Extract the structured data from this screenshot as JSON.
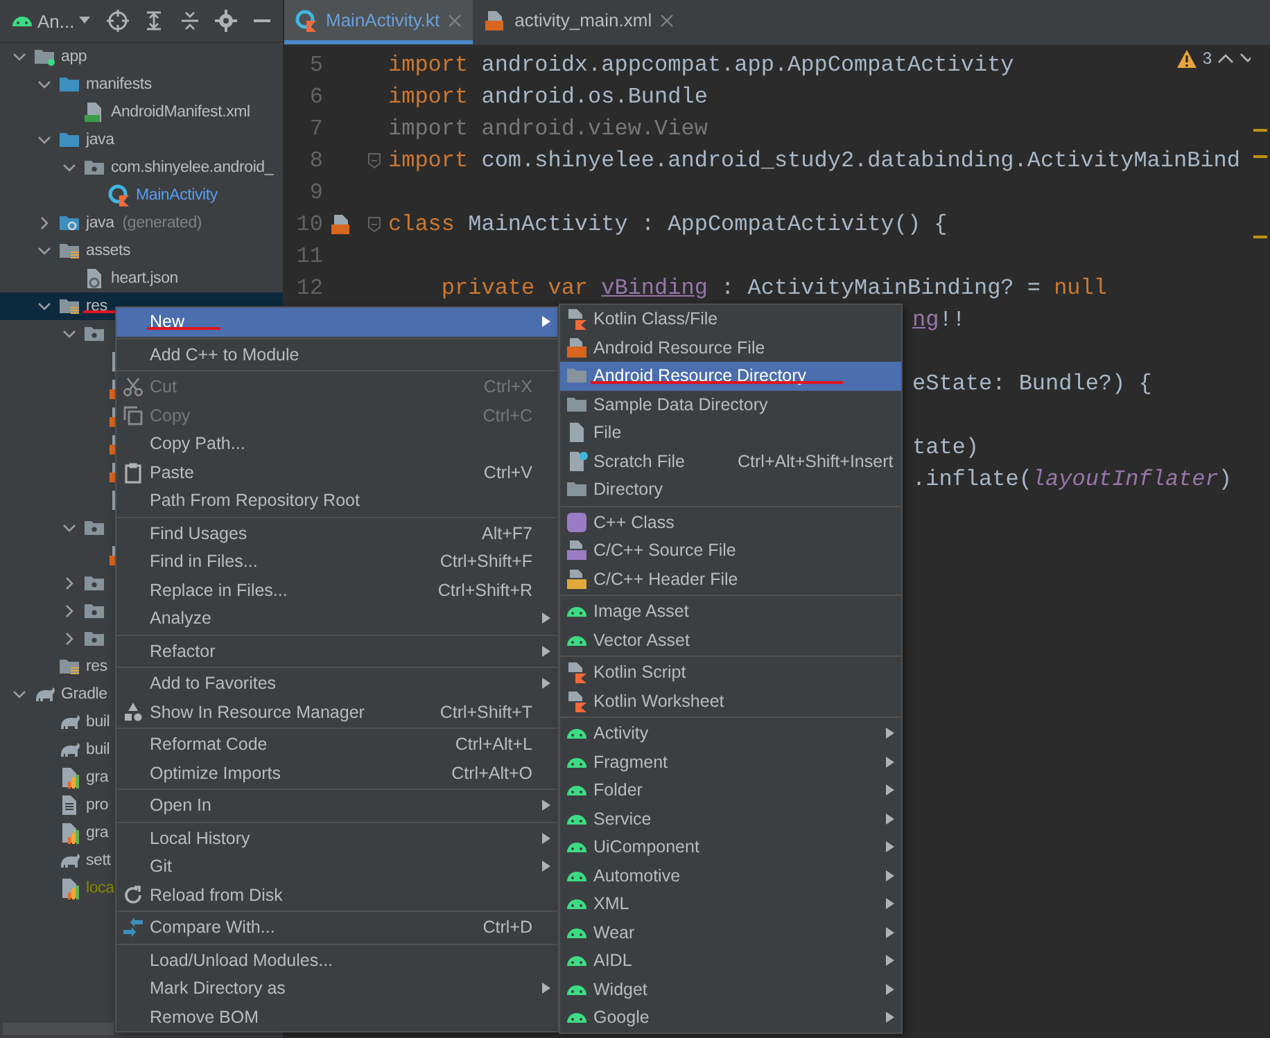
{
  "project_view": {
    "label": "An..."
  },
  "tree": [
    {
      "label": "app",
      "kind": "module-folder",
      "expanded": true,
      "selected": false,
      "children": [
        {
          "label": "manifests",
          "kind": "source-folder",
          "expanded": true,
          "selected": false,
          "children": [
            {
              "label": "AndroidManifest.xml",
              "kind": "manifest-file",
              "selected": false
            }
          ]
        },
        {
          "label": "java",
          "kind": "source-folder",
          "expanded": true,
          "selected": false,
          "children": [
            {
              "label": "com.shinyelee.android_",
              "kind": "package",
              "expanded": true,
              "selected": false,
              "children": [
                {
                  "label": "MainActivity",
                  "kind": "kotlin-class",
                  "modified": true,
                  "selected": false
                }
              ]
            }
          ]
        },
        {
          "label": "java",
          "note": "(generated)",
          "kind": "generated-folder",
          "expanded": false,
          "selected": false
        },
        {
          "label": "assets",
          "kind": "resource-folder",
          "expanded": true,
          "selected": false,
          "children": [
            {
              "label": "heart.json",
              "kind": "json-file",
              "selected": false
            }
          ]
        },
        {
          "label": "res",
          "kind": "resource-folder",
          "expanded": true,
          "selected": true,
          "annotated": true,
          "children": [
            {
              "kind": "package",
              "expanded": true,
              "selected": false,
              "children": [
                {
                  "kind": "file",
                  "selected": false
                },
                {
                  "kind": "layout-file",
                  "selected": false
                },
                {
                  "kind": "layout-file",
                  "selected": false
                },
                {
                  "kind": "layout-file",
                  "selected": false
                },
                {
                  "kind": "layout-file",
                  "selected": false
                },
                {
                  "kind": "file",
                  "selected": false
                }
              ]
            },
            {
              "kind": "package",
              "expanded": true,
              "selected": false,
              "children": [
                {
                  "kind": "layout-file",
                  "selected": false
                }
              ]
            },
            {
              "kind": "package",
              "expanded": false,
              "selected": false
            },
            {
              "kind": "package",
              "expanded": false,
              "selected": false
            },
            {
              "kind": "package",
              "expanded": false,
              "selected": false
            }
          ]
        },
        {
          "label": "res",
          "kind": "resource-folder",
          "selected": false
        }
      ]
    },
    {
      "label": "Gradle",
      "kind": "gradle",
      "expanded": true,
      "selected": false,
      "children": [
        {
          "label": "buil",
          "kind": "gradle",
          "selected": false
        },
        {
          "label": "buil",
          "kind": "gradle",
          "selected": false
        },
        {
          "label": "gra",
          "kind": "properties-file",
          "selected": false
        },
        {
          "label": "pro",
          "kind": "text-file",
          "selected": false
        },
        {
          "label": "gra",
          "kind": "properties-file",
          "selected": false
        },
        {
          "label": "sett",
          "kind": "gradle",
          "selected": false
        },
        {
          "label": "loca",
          "kind": "properties-file",
          "ignored": true,
          "selected": false
        }
      ]
    }
  ],
  "tabs": [
    {
      "label": "MainActivity.kt",
      "kind": "kotlin-class",
      "selected": true
    },
    {
      "label": "activity_main.xml",
      "kind": "layout-file",
      "selected": false
    }
  ],
  "editor": {
    "warnings": "3",
    "lines": [
      {
        "kind": "line",
        "number": "5",
        "tokens": [
          {
            "text": "import",
            "kind": "keyword"
          },
          {
            "text": " androidx.appcompat.app.AppCompatActivity",
            "kind": "plain"
          }
        ]
      },
      {
        "kind": "line",
        "number": "6",
        "tokens": [
          {
            "text": "import",
            "kind": "keyword"
          },
          {
            "text": " android.os.Bundle",
            "kind": "plain"
          }
        ]
      },
      {
        "kind": "line",
        "number": "7",
        "tokens": [
          {
            "text": "import android.view.View",
            "kind": "unused"
          }
        ]
      },
      {
        "kind": "line",
        "number": "8",
        "fold": true,
        "tokens": [
          {
            "text": "import",
            "kind": "keyword"
          },
          {
            "text": " com.shinyelee.android_study2.databinding.ActivityMainBind",
            "kind": "plain"
          }
        ]
      },
      {
        "kind": "line",
        "number": "9"
      },
      {
        "kind": "line",
        "number": "10",
        "fold": true,
        "gutter_marker": true,
        "tokens": [
          {
            "text": "class",
            "kind": "keyword"
          },
          {
            "text": " MainActivity : AppCompatActivity() {",
            "kind": "plain"
          }
        ]
      },
      {
        "kind": "line",
        "number": "11"
      },
      {
        "kind": "line",
        "number": "12",
        "tokens": [
          {
            "text": "    private var ",
            "kind": "keyword"
          },
          {
            "text": "vBinding",
            "kind": "field"
          },
          {
            "text": " : ActivityMainBinding? = ",
            "kind": "plain"
          },
          {
            "text": "null",
            "kind": "keyword"
          }
        ]
      },
      {
        "kind": "tail",
        "tokens": [
          {
            "text": "ng",
            "kind": "field"
          },
          {
            "text": "!!",
            "kind": "plain"
          }
        ]
      },
      {
        "kind": "blank"
      },
      {
        "kind": "tail",
        "tokens": [
          {
            "text": "eState: Bundle?) {",
            "kind": "plain"
          }
        ]
      },
      {
        "kind": "blank"
      },
      {
        "kind": "tail",
        "tokens": [
          {
            "text": "tate)",
            "kind": "plain"
          }
        ]
      },
      {
        "kind": "tail",
        "tokens": [
          {
            "text": ".inflate(",
            "kind": "plain"
          },
          {
            "text": "layoutInflater",
            "kind": "italic-field"
          },
          {
            "text": ")",
            "kind": "plain"
          }
        ]
      }
    ]
  },
  "context_menu": {
    "groups": [
      [
        {
          "label": "New",
          "submenu": true,
          "disabled": false,
          "selected": true,
          "annotated": true
        }
      ],
      [
        {
          "label": "Add C++ to Module",
          "submenu": false,
          "disabled": false,
          "selected": false
        }
      ],
      [
        {
          "label": "Cut",
          "kind": "scissors",
          "shortcut": "Ctrl+X",
          "submenu": false,
          "disabled": true,
          "selected": false
        },
        {
          "label": "Copy",
          "kind": "copy",
          "shortcut": "Ctrl+C",
          "submenu": false,
          "disabled": true,
          "selected": false
        },
        {
          "label": "Copy Path...",
          "submenu": false,
          "disabled": false,
          "selected": false
        },
        {
          "label": "Paste",
          "kind": "clipboard",
          "shortcut": "Ctrl+V",
          "submenu": false,
          "disabled": false,
          "selected": false
        },
        {
          "label": "Path From Repository Root",
          "submenu": false,
          "disabled": false,
          "selected": false
        }
      ],
      [
        {
          "label": "Find Usages",
          "shortcut": "Alt+F7",
          "submenu": false,
          "disabled": false,
          "selected": false
        },
        {
          "label": "Find in Files...",
          "shortcut": "Ctrl+Shift+F",
          "submenu": false,
          "disabled": false,
          "selected": false
        },
        {
          "label": "Replace in Files...",
          "shortcut": "Ctrl+Shift+R",
          "submenu": false,
          "disabled": false,
          "selected": false
        },
        {
          "label": "Analyze",
          "submenu": true,
          "disabled": false,
          "selected": false
        }
      ],
      [
        {
          "label": "Refactor",
          "submenu": true,
          "disabled": false,
          "selected": false
        }
      ],
      [
        {
          "label": "Add to Favorites",
          "submenu": true,
          "disabled": false,
          "selected": false
        },
        {
          "label": "Show In Resource Manager",
          "kind": "shapes",
          "shortcut": "Ctrl+Shift+T",
          "submenu": false,
          "disabled": false,
          "selected": false
        }
      ],
      [
        {
          "label": "Reformat Code",
          "shortcut": "Ctrl+Alt+L",
          "submenu": false,
          "disabled": false,
          "selected": false
        },
        {
          "label": "Optimize Imports",
          "shortcut": "Ctrl+Alt+O",
          "submenu": false,
          "disabled": false,
          "selected": false
        }
      ],
      [
        {
          "label": "Open In",
          "submenu": true,
          "disabled": false,
          "selected": false
        }
      ],
      [
        {
          "label": "Local History",
          "submenu": true,
          "disabled": false,
          "selected": false
        },
        {
          "label": "Git",
          "submenu": true,
          "disabled": false,
          "selected": false
        },
        {
          "label": "Reload from Disk",
          "kind": "reload",
          "submenu": false,
          "disabled": false,
          "selected": false
        }
      ],
      [
        {
          "label": "Compare With...",
          "kind": "compare",
          "shortcut": "Ctrl+D",
          "submenu": false,
          "disabled": false,
          "selected": false
        }
      ],
      [
        {
          "label": "Load/Unload Modules...",
          "submenu": false,
          "disabled": false,
          "selected": false
        },
        {
          "label": "Mark Directory as",
          "submenu": true,
          "disabled": false,
          "selected": false
        },
        {
          "label": "Remove BOM",
          "submenu": false,
          "disabled": false,
          "selected": false
        }
      ]
    ]
  },
  "submenu": {
    "groups": [
      [
        {
          "label": "Kotlin Class/File",
          "kind": "kotlin-file",
          "submenu": false,
          "selected": false
        },
        {
          "label": "Android Resource File",
          "kind": "resource-file",
          "submenu": false,
          "selected": false
        },
        {
          "label": "Android Resource Directory",
          "kind": "folder",
          "submenu": false,
          "selected": true,
          "annotated": true
        },
        {
          "label": "Sample Data Directory",
          "kind": "folder",
          "submenu": false,
          "selected": false
        },
        {
          "label": "File",
          "kind": "file",
          "submenu": false,
          "selected": false
        },
        {
          "label": "Scratch File",
          "kind": "scratch-file",
          "shortcut": "Ctrl+Alt+Shift+Insert",
          "submenu": false,
          "selected": false
        },
        {
          "label": "Directory",
          "kind": "folder",
          "submenu": false,
          "selected": false
        }
      ],
      [
        {
          "label": "C++ Class",
          "kind": "cpp-class",
          "submenu": false,
          "selected": false
        },
        {
          "label": "C/C++ Source File",
          "kind": "cpp-source",
          "submenu": false,
          "selected": false
        },
        {
          "label": "C/C++ Header File",
          "kind": "cpp-header",
          "submenu": false,
          "selected": false
        }
      ],
      [
        {
          "label": "Image Asset",
          "kind": "android",
          "submenu": false,
          "selected": false
        },
        {
          "label": "Vector Asset",
          "kind": "android",
          "submenu": false,
          "selected": false
        }
      ],
      [
        {
          "label": "Kotlin Script",
          "kind": "kotlin-file",
          "submenu": false,
          "selected": false
        },
        {
          "label": "Kotlin Worksheet",
          "kind": "kotlin-file",
          "submenu": false,
          "selected": false
        }
      ],
      [
        {
          "label": "Activity",
          "kind": "android",
          "submenu": true,
          "selected": false
        },
        {
          "label": "Fragment",
          "kind": "android",
          "submenu": true,
          "selected": false
        },
        {
          "label": "Folder",
          "kind": "android",
          "submenu": true,
          "selected": false
        },
        {
          "label": "Service",
          "kind": "android",
          "submenu": true,
          "selected": false
        },
        {
          "label": "UiComponent",
          "kind": "android",
          "submenu": true,
          "selected": false
        },
        {
          "label": "Automotive",
          "kind": "android",
          "submenu": true,
          "selected": false
        },
        {
          "label": "XML",
          "kind": "android",
          "submenu": true,
          "selected": false
        },
        {
          "label": "Wear",
          "kind": "android",
          "submenu": true,
          "selected": false
        },
        {
          "label": "AIDL",
          "kind": "android",
          "submenu": true,
          "selected": false
        },
        {
          "label": "Widget",
          "kind": "android",
          "submenu": true,
          "selected": false
        },
        {
          "label": "Google",
          "kind": "android",
          "submenu": true,
          "selected": false
        }
      ]
    ]
  }
}
